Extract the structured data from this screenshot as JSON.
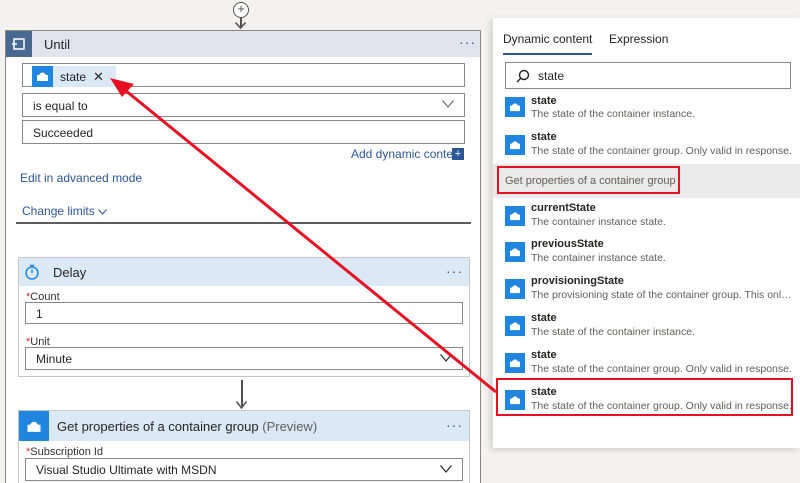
{
  "until": {
    "title": "Until",
    "token_label": "state",
    "operator": "is equal to",
    "value": "Succeeded",
    "add_dynamic_label": "Add dynamic content",
    "advanced_mode_label": "Edit in advanced mode",
    "change_limits_label": "Change limits"
  },
  "delay": {
    "title": "Delay",
    "count_label": "Count",
    "count_value": "1",
    "unit_label": "Unit",
    "unit_value": "Minute"
  },
  "get_props": {
    "title": "Get properties of a container group",
    "preview": "(Preview)",
    "subscription_label": "Subscription Id",
    "subscription_value": "Visual Studio Ultimate with MSDN"
  },
  "panel": {
    "tabs": [
      "Dynamic content",
      "Expression"
    ],
    "search_value": "state",
    "group_label": "Get properties of a container group",
    "items_above": [
      {
        "name": "state",
        "desc": "The state of the container instance."
      },
      {
        "name": "state",
        "desc": "The state of the container group. Only valid in response."
      }
    ],
    "items": [
      {
        "name": "currentState",
        "desc": "The container instance state."
      },
      {
        "name": "previousState",
        "desc": "The container instance state."
      },
      {
        "name": "provisioningState",
        "desc": "The provisioning state of the container group. This only a..."
      },
      {
        "name": "state",
        "desc": "The state of the container instance."
      },
      {
        "name": "state",
        "desc": "The state of the container group. Only valid in response."
      },
      {
        "name": "state",
        "desc": "The state of the container group. Only valid in response."
      }
    ]
  },
  "colors": {
    "accent": "#2b579a",
    "until_icon_bg": "#486991",
    "connector_icon_bg": "#1f85de",
    "highlight_red": "#e81123"
  }
}
